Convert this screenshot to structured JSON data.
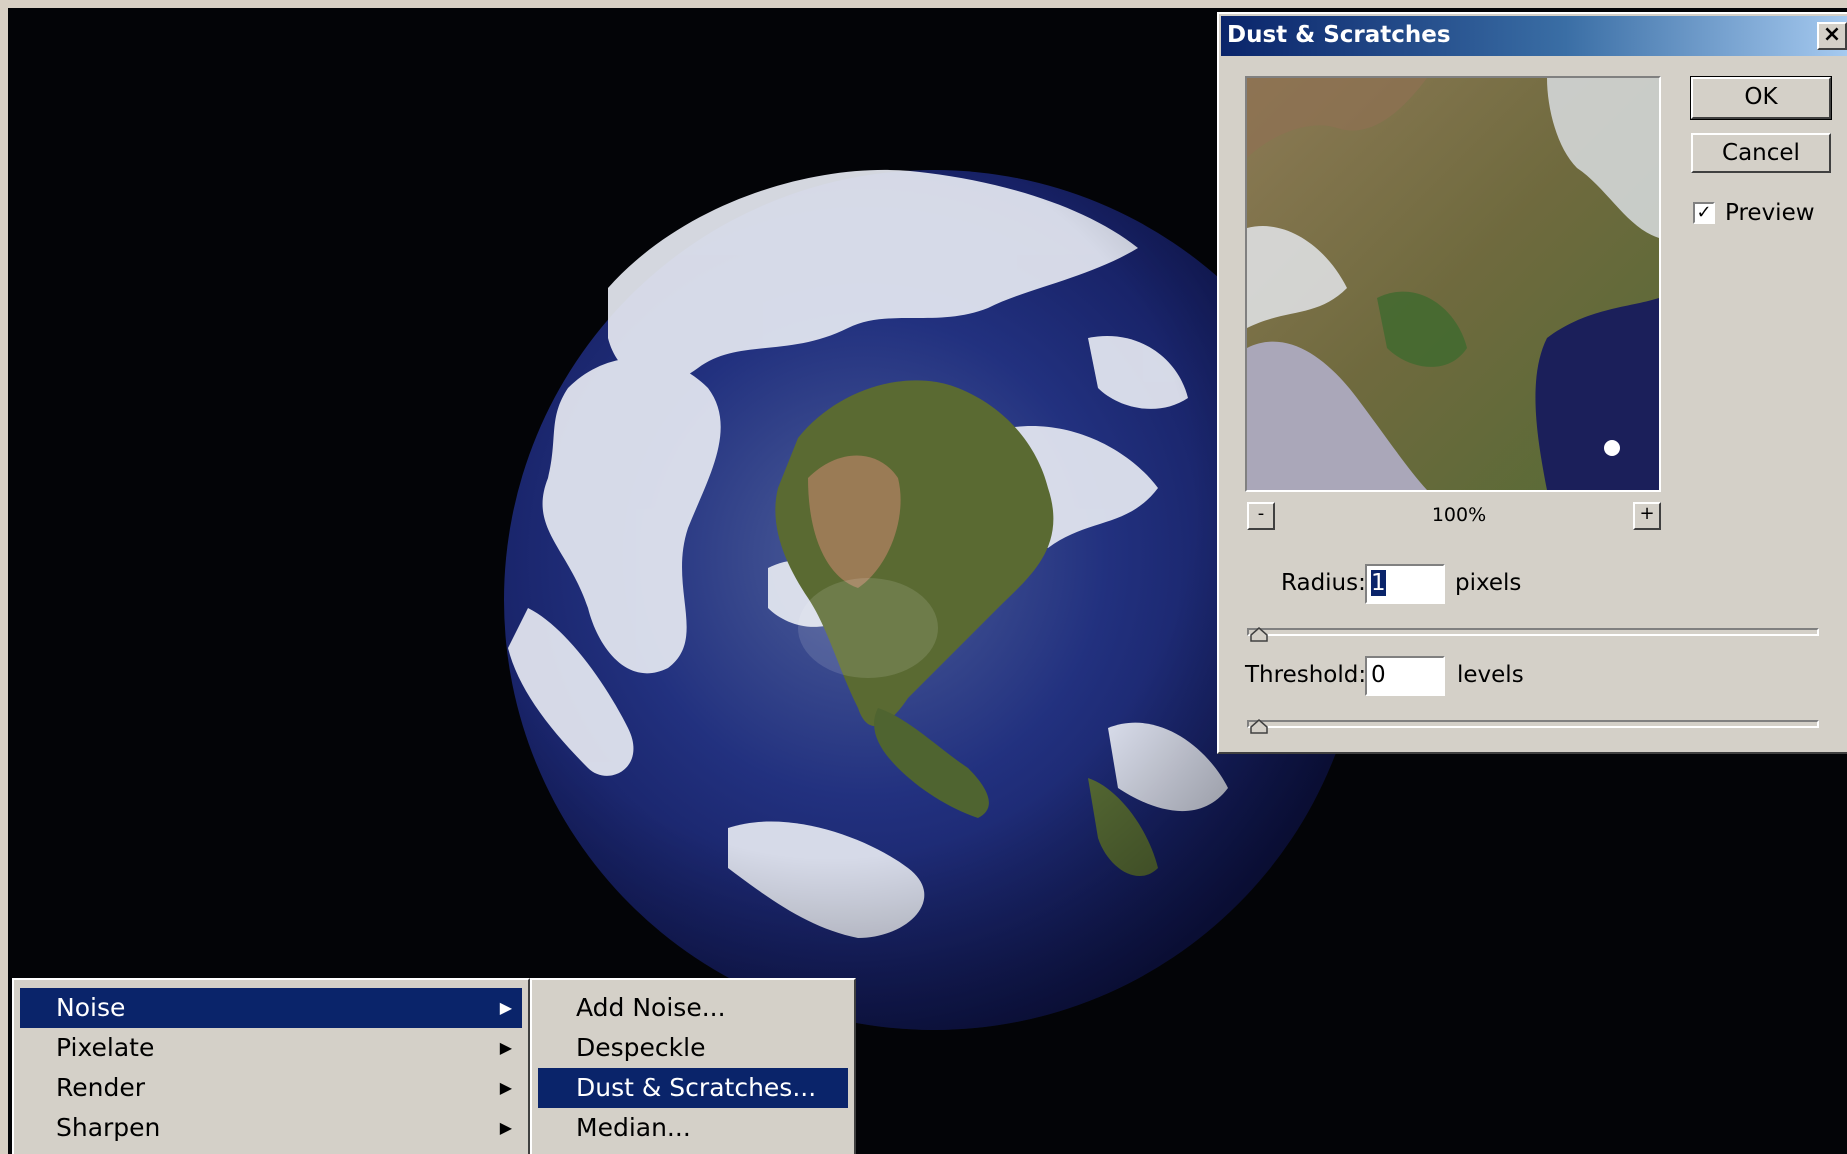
{
  "dialog": {
    "title": "Dust & Scratches",
    "ok_label": "OK",
    "cancel_label": "Cancel",
    "preview_label": "Preview",
    "preview_checked": true,
    "zoom_out_label": "-",
    "zoom_in_label": "+",
    "zoom_level": "100%",
    "radius": {
      "label": "Radius:",
      "value": "1",
      "unit": "pixels"
    },
    "threshold": {
      "label": "Threshold:",
      "value": "0",
      "unit": "levels"
    },
    "close_label": "×"
  },
  "filter_menu": {
    "items": [
      {
        "label": "Noise",
        "highlighted": true,
        "submenu": true
      },
      {
        "label": "Pixelate",
        "highlighted": false,
        "submenu": true
      },
      {
        "label": "Render",
        "highlighted": false,
        "submenu": true
      },
      {
        "label": "Sharpen",
        "highlighted": false,
        "submenu": true
      }
    ],
    "arrow_glyph": "▶"
  },
  "noise_submenu": {
    "items": [
      {
        "label": "Add Noise...",
        "highlighted": false
      },
      {
        "label": "Despeckle",
        "highlighted": false
      },
      {
        "label": "Dust & Scratches...",
        "highlighted": true
      },
      {
        "label": "Median...",
        "highlighted": false
      }
    ]
  },
  "colors": {
    "highlight": "#0a246a",
    "dialog_face": "#d4d0c8",
    "space_background": "#030407",
    "ocean": "#1f2d7a"
  }
}
